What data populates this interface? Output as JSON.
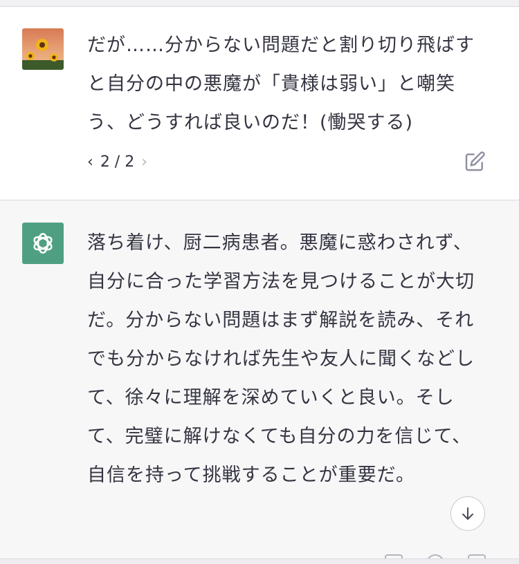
{
  "conversation": {
    "user_message": "だが……分からない問題だと割り切り飛ばすと自分の中の悪魔が「貴様は弱い」と嘲笑う、どうすれば良いのだ！(慟哭する)",
    "assistant_message": "落ち着け、厨二病患者。悪魔に惑わされず、自分に合った学習方法を見つけることが大切だ。分からない問題はまず解説を読み、それでも分からなければ先生や友人に聞くなどして、徐々に理解を深めていくと良い。そして、完璧に解けなくても自分の力を信じて、自信を持って挑戦することが重要だ。"
  },
  "pager": {
    "prev": "‹",
    "label": "2 / 2",
    "next": "›"
  },
  "icons": {
    "user_avatar": "sunflower-avatar",
    "assistant_avatar": "openai-logo-icon",
    "edit": "edit-icon",
    "scroll_down": "arrow-down-icon"
  },
  "colors": {
    "assistant_avatar_bg": "#4fa083",
    "assistant_bg": "#f7f7f8",
    "text": "#343541"
  }
}
